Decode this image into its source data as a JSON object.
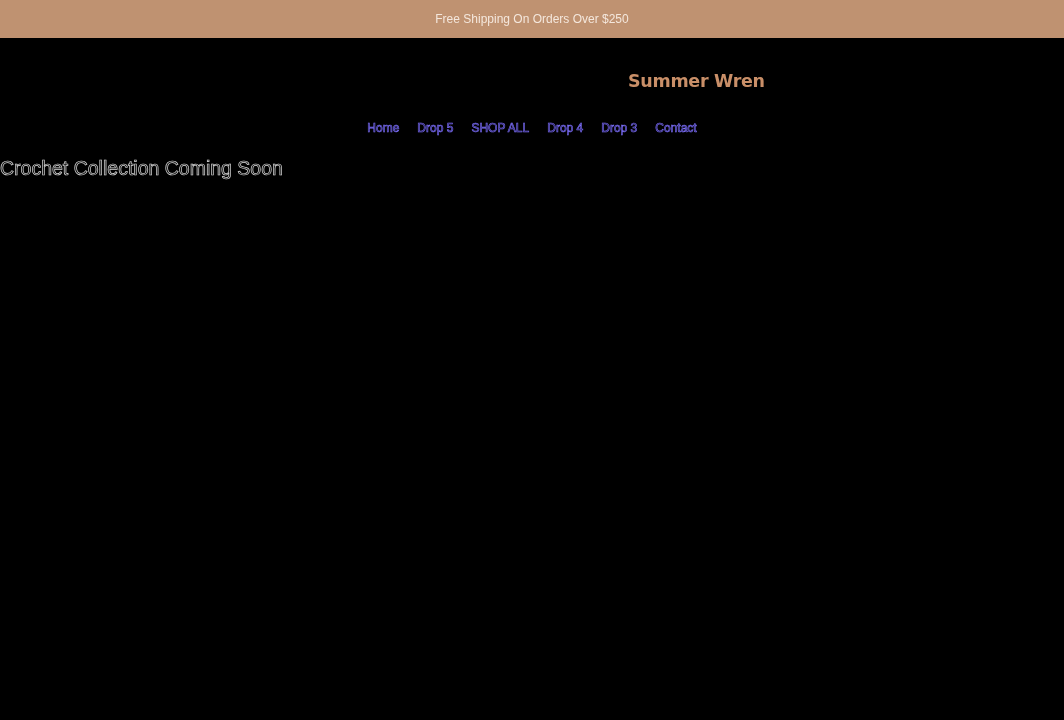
{
  "announcement_bar": {
    "text": "Free Shipping On Orders Over $250"
  },
  "header": {
    "logo": "Summer Wren"
  },
  "nav": {
    "items": [
      {
        "label": "Home"
      },
      {
        "label": "Drop 5"
      },
      {
        "label": "SHOP ALL"
      },
      {
        "label": "Drop 4"
      },
      {
        "label": "Drop 3"
      },
      {
        "label": "Contact"
      }
    ]
  },
  "main": {
    "heading": "Crochet Collection Coming Soon"
  }
}
